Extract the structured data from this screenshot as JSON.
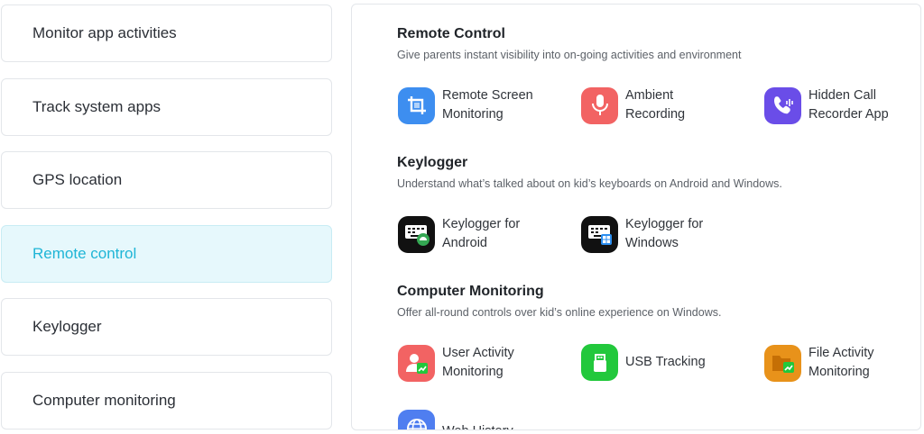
{
  "sidebar": {
    "items": [
      {
        "label": "Monitor app activities"
      },
      {
        "label": "Track system apps"
      },
      {
        "label": "GPS location"
      },
      {
        "label": "Remote control"
      },
      {
        "label": "Keylogger"
      },
      {
        "label": "Computer monitoring"
      }
    ],
    "active_index": 3
  },
  "sections": {
    "remote": {
      "title": "Remote Control",
      "desc": "Give parents instant visibility into on-going activities and environment",
      "features": [
        {
          "line1": "Remote Screen",
          "line2": "Monitoring",
          "icon": "crop-screen-icon"
        },
        {
          "line1": "Ambient",
          "line2": "Recording",
          "icon": "microphone-icon"
        },
        {
          "line1": "Hidden Call",
          "line2": "Recorder App",
          "icon": "phone-call-icon"
        }
      ]
    },
    "keylogger": {
      "title": "Keylogger",
      "desc": "Understand what’s talked about on kid’s keyboards on Android and Windows.",
      "features": [
        {
          "line1": "Keylogger for",
          "line2": "Android",
          "icon": "keyboard-android-icon"
        },
        {
          "line1": "Keylogger for",
          "line2": "Windows",
          "icon": "keyboard-windows-icon"
        }
      ]
    },
    "computer": {
      "title": "Computer Monitoring",
      "desc": "Offer all-round controls over kid’s online experience on Windows.",
      "features": [
        {
          "line1": "User Activity",
          "line2": "Monitoring",
          "icon": "user-activity-icon"
        },
        {
          "line1": "USB Tracking",
          "line2": "",
          "icon": "usb-icon"
        },
        {
          "line1": "File Activity",
          "line2": "Monitoring",
          "icon": "folder-chart-icon"
        },
        {
          "line1": "Web History",
          "line2": "",
          "icon": "globe-icon"
        }
      ]
    }
  },
  "colors": {
    "active_text": "#1fb5d6",
    "active_bg": "#e6f8fc",
    "blue": "#3d8ef0",
    "red": "#f26363",
    "purple": "#6a4de8",
    "green": "#22c83c",
    "orange": "#e8921a"
  }
}
